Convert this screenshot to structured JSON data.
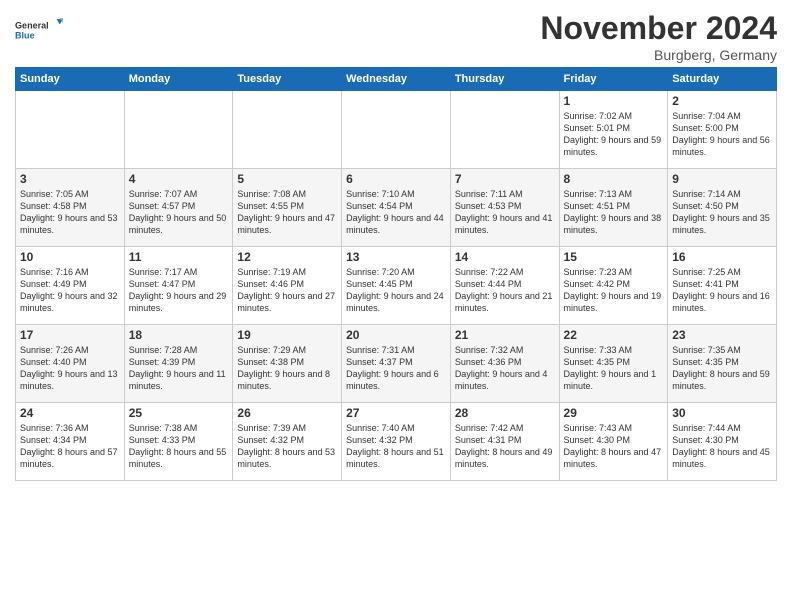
{
  "logo": {
    "line1": "General",
    "line2": "Blue"
  },
  "title": "November 2024",
  "subtitle": "Burgberg, Germany",
  "weekdays": [
    "Sunday",
    "Monday",
    "Tuesday",
    "Wednesday",
    "Thursday",
    "Friday",
    "Saturday"
  ],
  "weeks": [
    [
      {
        "day": "",
        "info": ""
      },
      {
        "day": "",
        "info": ""
      },
      {
        "day": "",
        "info": ""
      },
      {
        "day": "",
        "info": ""
      },
      {
        "day": "",
        "info": ""
      },
      {
        "day": "1",
        "info": "Sunrise: 7:02 AM\nSunset: 5:01 PM\nDaylight: 9 hours and 59 minutes."
      },
      {
        "day": "2",
        "info": "Sunrise: 7:04 AM\nSunset: 5:00 PM\nDaylight: 9 hours and 56 minutes."
      }
    ],
    [
      {
        "day": "3",
        "info": "Sunrise: 7:05 AM\nSunset: 4:58 PM\nDaylight: 9 hours and 53 minutes."
      },
      {
        "day": "4",
        "info": "Sunrise: 7:07 AM\nSunset: 4:57 PM\nDaylight: 9 hours and 50 minutes."
      },
      {
        "day": "5",
        "info": "Sunrise: 7:08 AM\nSunset: 4:55 PM\nDaylight: 9 hours and 47 minutes."
      },
      {
        "day": "6",
        "info": "Sunrise: 7:10 AM\nSunset: 4:54 PM\nDaylight: 9 hours and 44 minutes."
      },
      {
        "day": "7",
        "info": "Sunrise: 7:11 AM\nSunset: 4:53 PM\nDaylight: 9 hours and 41 minutes."
      },
      {
        "day": "8",
        "info": "Sunrise: 7:13 AM\nSunset: 4:51 PM\nDaylight: 9 hours and 38 minutes."
      },
      {
        "day": "9",
        "info": "Sunrise: 7:14 AM\nSunset: 4:50 PM\nDaylight: 9 hours and 35 minutes."
      }
    ],
    [
      {
        "day": "10",
        "info": "Sunrise: 7:16 AM\nSunset: 4:49 PM\nDaylight: 9 hours and 32 minutes."
      },
      {
        "day": "11",
        "info": "Sunrise: 7:17 AM\nSunset: 4:47 PM\nDaylight: 9 hours and 29 minutes."
      },
      {
        "day": "12",
        "info": "Sunrise: 7:19 AM\nSunset: 4:46 PM\nDaylight: 9 hours and 27 minutes."
      },
      {
        "day": "13",
        "info": "Sunrise: 7:20 AM\nSunset: 4:45 PM\nDaylight: 9 hours and 24 minutes."
      },
      {
        "day": "14",
        "info": "Sunrise: 7:22 AM\nSunset: 4:44 PM\nDaylight: 9 hours and 21 minutes."
      },
      {
        "day": "15",
        "info": "Sunrise: 7:23 AM\nSunset: 4:42 PM\nDaylight: 9 hours and 19 minutes."
      },
      {
        "day": "16",
        "info": "Sunrise: 7:25 AM\nSunset: 4:41 PM\nDaylight: 9 hours and 16 minutes."
      }
    ],
    [
      {
        "day": "17",
        "info": "Sunrise: 7:26 AM\nSunset: 4:40 PM\nDaylight: 9 hours and 13 minutes."
      },
      {
        "day": "18",
        "info": "Sunrise: 7:28 AM\nSunset: 4:39 PM\nDaylight: 9 hours and 11 minutes."
      },
      {
        "day": "19",
        "info": "Sunrise: 7:29 AM\nSunset: 4:38 PM\nDaylight: 9 hours and 8 minutes."
      },
      {
        "day": "20",
        "info": "Sunrise: 7:31 AM\nSunset: 4:37 PM\nDaylight: 9 hours and 6 minutes."
      },
      {
        "day": "21",
        "info": "Sunrise: 7:32 AM\nSunset: 4:36 PM\nDaylight: 9 hours and 4 minutes."
      },
      {
        "day": "22",
        "info": "Sunrise: 7:33 AM\nSunset: 4:35 PM\nDaylight: 9 hours and 1 minute."
      },
      {
        "day": "23",
        "info": "Sunrise: 7:35 AM\nSunset: 4:35 PM\nDaylight: 8 hours and 59 minutes."
      }
    ],
    [
      {
        "day": "24",
        "info": "Sunrise: 7:36 AM\nSunset: 4:34 PM\nDaylight: 8 hours and 57 minutes."
      },
      {
        "day": "25",
        "info": "Sunrise: 7:38 AM\nSunset: 4:33 PM\nDaylight: 8 hours and 55 minutes."
      },
      {
        "day": "26",
        "info": "Sunrise: 7:39 AM\nSunset: 4:32 PM\nDaylight: 8 hours and 53 minutes."
      },
      {
        "day": "27",
        "info": "Sunrise: 7:40 AM\nSunset: 4:32 PM\nDaylight: 8 hours and 51 minutes."
      },
      {
        "day": "28",
        "info": "Sunrise: 7:42 AM\nSunset: 4:31 PM\nDaylight: 8 hours and 49 minutes."
      },
      {
        "day": "29",
        "info": "Sunrise: 7:43 AM\nSunset: 4:30 PM\nDaylight: 8 hours and 47 minutes."
      },
      {
        "day": "30",
        "info": "Sunrise: 7:44 AM\nSunset: 4:30 PM\nDaylight: 8 hours and 45 minutes."
      }
    ]
  ]
}
